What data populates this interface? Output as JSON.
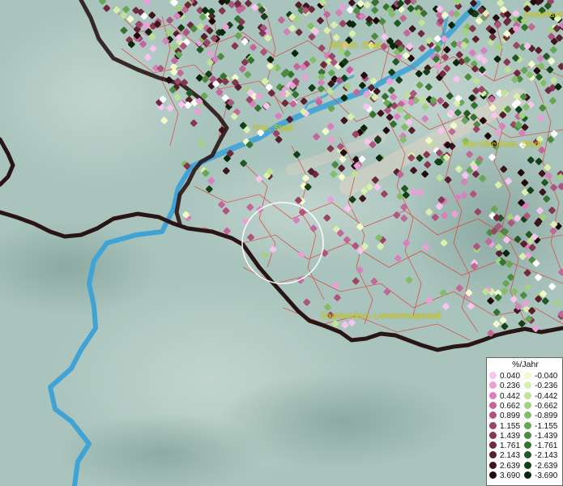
{
  "places": [
    {
      "name": "Kastellaun",
      "id": "kastellaun"
    },
    {
      "name": "Wittlich, Stadt",
      "id": "wittlich"
    },
    {
      "name": "Trier, Stadt",
      "id": "trier"
    },
    {
      "name": "Idar-Oberstein, Stadt",
      "id": "idar-oberstein"
    },
    {
      "name": "Saarbrücken, Landeshauptstadt",
      "id": "saarbruecken"
    }
  ],
  "legend": {
    "title": "%/Jahr",
    "positive": [
      {
        "value": "0.040",
        "color": "#f6c4ec"
      },
      {
        "value": "0.236",
        "color": "#e8a0d6"
      },
      {
        "value": "0.442",
        "color": "#d680bc"
      },
      {
        "value": "0.662",
        "color": "#c26798"
      },
      {
        "value": "0.899",
        "color": "#ad557f"
      },
      {
        "value": "1.155",
        "color": "#9a4566"
      },
      {
        "value": "1.439",
        "color": "#86374f"
      },
      {
        "value": "1.761",
        "color": "#702a3d"
      },
      {
        "value": "2.143",
        "color": "#58202c"
      },
      {
        "value": "2.639",
        "color": "#3e151c"
      },
      {
        "value": "3.690",
        "color": "#230a0e"
      }
    ],
    "negative": [
      {
        "value": "-0.040",
        "color": "#f1fac8"
      },
      {
        "value": "-0.236",
        "color": "#d9efad"
      },
      {
        "value": "-0.442",
        "color": "#bfe296"
      },
      {
        "value": "-0.662",
        "color": "#a2d17f"
      },
      {
        "value": "-0.899",
        "color": "#84bd69"
      },
      {
        "value": "-1.155",
        "color": "#66a654"
      },
      {
        "value": "-1.439",
        "color": "#4c8c41"
      },
      {
        "value": "-1.761",
        "color": "#357231"
      },
      {
        "value": "-2.143",
        "color": "#225824"
      },
      {
        "value": "-2.639",
        "color": "#143f17"
      },
      {
        "value": "-3.690",
        "color": "#08270b"
      }
    ]
  },
  "colors": {
    "terrain_light": "#a9c4bd",
    "terrain_dark": "#8aaba2",
    "river": "#3fa3d6",
    "state_border": "#2a1515",
    "municipal_border": "#e0403a",
    "label_text": "#d6d200"
  }
}
